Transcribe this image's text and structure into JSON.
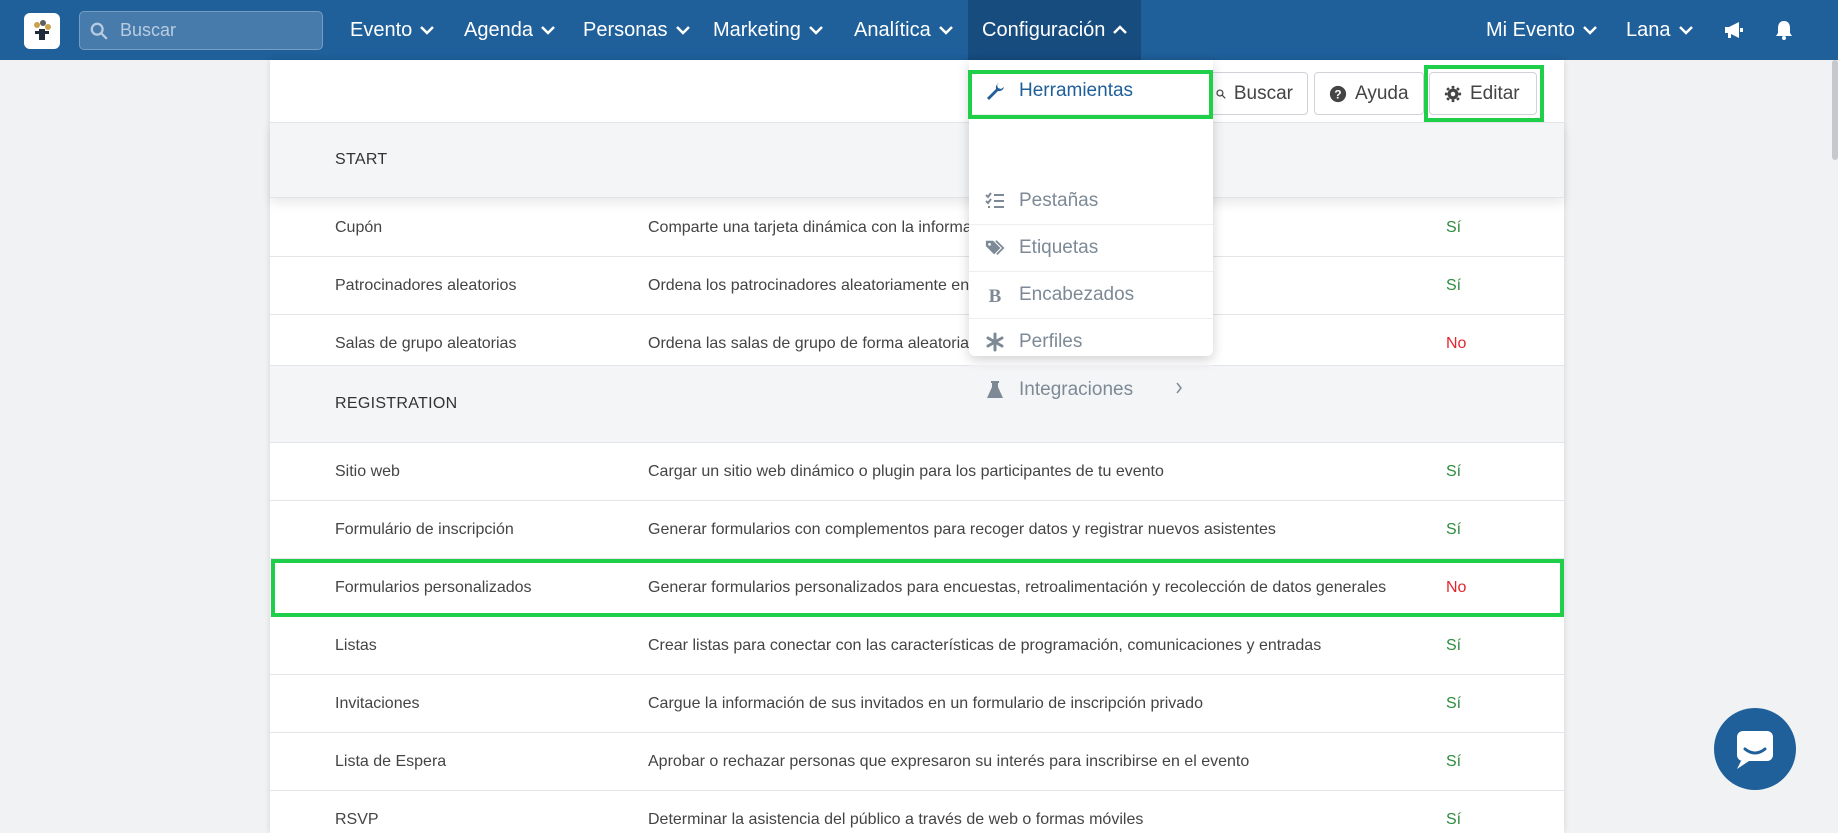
{
  "nav": {
    "search_placeholder": "Buscar",
    "items": [
      "Evento",
      "Agenda",
      "Personas",
      "Marketing",
      "Analítica",
      "Configuración"
    ],
    "right": [
      "Mi Evento",
      "Lana"
    ],
    "active": "Configuración"
  },
  "toolbar": {
    "buscar": "Buscar",
    "ayuda": "Ayuda",
    "editar": "Editar"
  },
  "dropdown": {
    "items": [
      "Herramientas",
      "Pestañas",
      "Etiquetas",
      "Encabezados",
      "Perfiles",
      "Integraciones"
    ]
  },
  "sections": [
    {
      "title": "START",
      "rows": [
        {
          "name": "Cupón",
          "desc": "Comparte una tarjeta dinámica con la informa",
          "value": "Sí"
        },
        {
          "name": "Patrocinadores aleatorios",
          "desc": "Ordena los patrocinadores aleatoriamente en",
          "value": "Sí"
        },
        {
          "name": "Salas de grupo aleatorias",
          "desc": "Ordena las salas de grupo de forma aleatoria",
          "value": "No"
        }
      ]
    },
    {
      "title": "REGISTRATION",
      "rows": [
        {
          "name": "Sitio web",
          "desc": "Cargar un sitio web dinámico o plugin para los participantes de tu evento",
          "value": "Sí"
        },
        {
          "name": "Formulário de inscripción",
          "desc": "Generar formularios con complementos para recoger datos y registrar nuevos asistentes",
          "value": "Sí"
        },
        {
          "name": "Formularios personalizados",
          "desc": "Generar formularios personalizados para encuestas, retroalimentación y recolección de datos generales",
          "value": "No"
        },
        {
          "name": "Listas",
          "desc": "Crear listas para conectar con las características de programación, comunicaciones y entradas",
          "value": "Sí"
        },
        {
          "name": "Invitaciones",
          "desc": "Cargue la información de sus invitados en un formulario de inscripción privado",
          "value": "Sí"
        },
        {
          "name": "Lista de Espera",
          "desc": "Aprobar o rechazar personas que expresaron su interés para inscribirse en el evento",
          "value": "Sí"
        },
        {
          "name": "RSVP",
          "desc": "Determinar la asistencia del público a través de web o formas móviles",
          "value": "Sí"
        }
      ]
    }
  ],
  "colors": {
    "nav_bg": "#1f5f9a",
    "highlight": "#1fcf4a",
    "yes": "#2e8b3d",
    "no": "#e0262e"
  },
  "icons": {
    "search": "search-icon",
    "megaphone": "megaphone-icon",
    "bell": "bell-icon",
    "chat": "chat-icon"
  }
}
